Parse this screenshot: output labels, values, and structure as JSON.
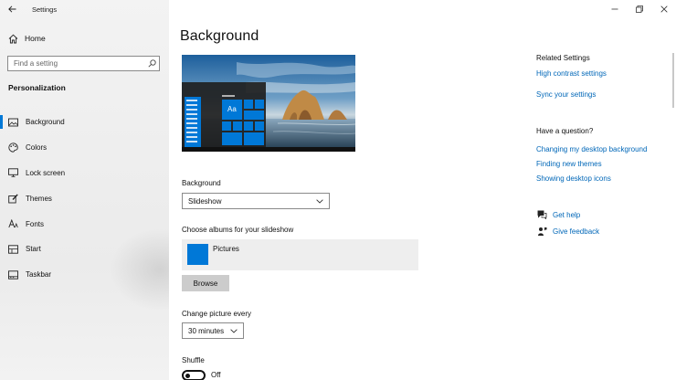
{
  "window": {
    "app_title": "Settings"
  },
  "sidebar": {
    "home_label": "Home",
    "search_placeholder": "Find a setting",
    "section_title": "Personalization",
    "items": [
      {
        "label": "Background",
        "icon": "picture-icon",
        "active": true
      },
      {
        "label": "Colors",
        "icon": "palette-icon",
        "active": false
      },
      {
        "label": "Lock screen",
        "icon": "monitor-icon",
        "active": false
      },
      {
        "label": "Themes",
        "icon": "brush-icon",
        "active": false
      },
      {
        "label": "Fonts",
        "icon": "font-icon",
        "active": false
      },
      {
        "label": "Start",
        "icon": "start-icon",
        "active": false
      },
      {
        "label": "Taskbar",
        "icon": "taskbar-icon",
        "active": false
      }
    ]
  },
  "main": {
    "title": "Background",
    "preview_tile_text": "Aa",
    "background_label": "Background",
    "background_value": "Slideshow",
    "albums_label": "Choose albums for your slideshow",
    "album_name": "Pictures",
    "browse_label": "Browse",
    "interval_label": "Change picture every",
    "interval_value": "30 minutes",
    "shuffle_label": "Shuffle",
    "shuffle_state": "Off"
  },
  "related": {
    "heading": "Related Settings",
    "links": [
      "High contrast settings",
      "Sync your settings"
    ],
    "question_heading": "Have a question?",
    "question_links": [
      "Changing my desktop background",
      "Finding new themes",
      "Showing desktop icons"
    ],
    "help_label": "Get help",
    "feedback_label": "Give feedback"
  },
  "colors": {
    "accent": "#0078d7",
    "link": "#0067b8"
  }
}
